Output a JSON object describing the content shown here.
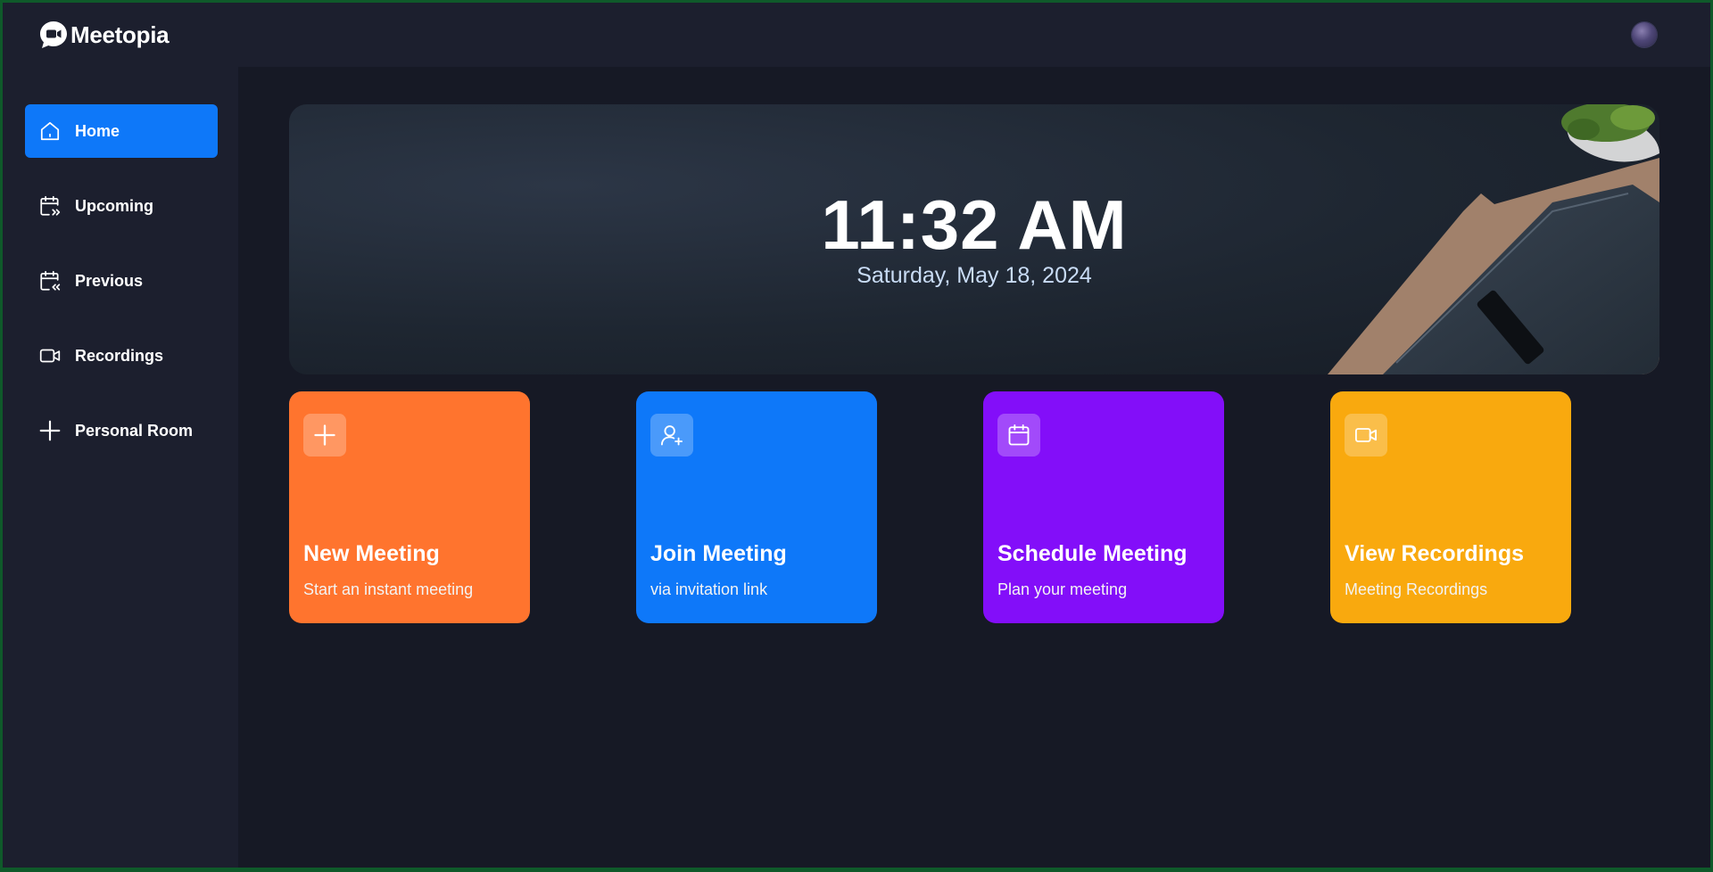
{
  "app": {
    "name": "Meetopia"
  },
  "colors": {
    "primary": "#0e78f9",
    "orange": "#ff742e",
    "blue": "#0e78f9",
    "purple": "#830ef9",
    "yellow": "#f9a90e",
    "background": "#161925",
    "panel": "#1c1f2e"
  },
  "sidebar": {
    "items": [
      {
        "label": "Home",
        "icon": "home-icon",
        "active": true
      },
      {
        "label": "Upcoming",
        "icon": "calendar-upcoming-icon",
        "active": false
      },
      {
        "label": "Previous",
        "icon": "calendar-previous-icon",
        "active": false
      },
      {
        "label": "Recordings",
        "icon": "video-icon",
        "active": false
      },
      {
        "label": "Personal Room",
        "icon": "plus-icon",
        "active": false
      }
    ]
  },
  "hero": {
    "time": "11:32 AM",
    "date": "Saturday, May 18, 2024"
  },
  "cards": [
    {
      "title": "New Meeting",
      "subtitle": "Start an instant meeting",
      "icon": "plus-icon",
      "color": "#ff742e"
    },
    {
      "title": "Join Meeting",
      "subtitle": "via invitation link",
      "icon": "add-user-icon",
      "color": "#0e78f9"
    },
    {
      "title": "Schedule Meeting",
      "subtitle": "Plan your meeting",
      "icon": "calendar-icon",
      "color": "#830ef9"
    },
    {
      "title": "View Recordings",
      "subtitle": "Meeting Recordings",
      "icon": "video-icon",
      "color": "#f9a90e"
    }
  ]
}
